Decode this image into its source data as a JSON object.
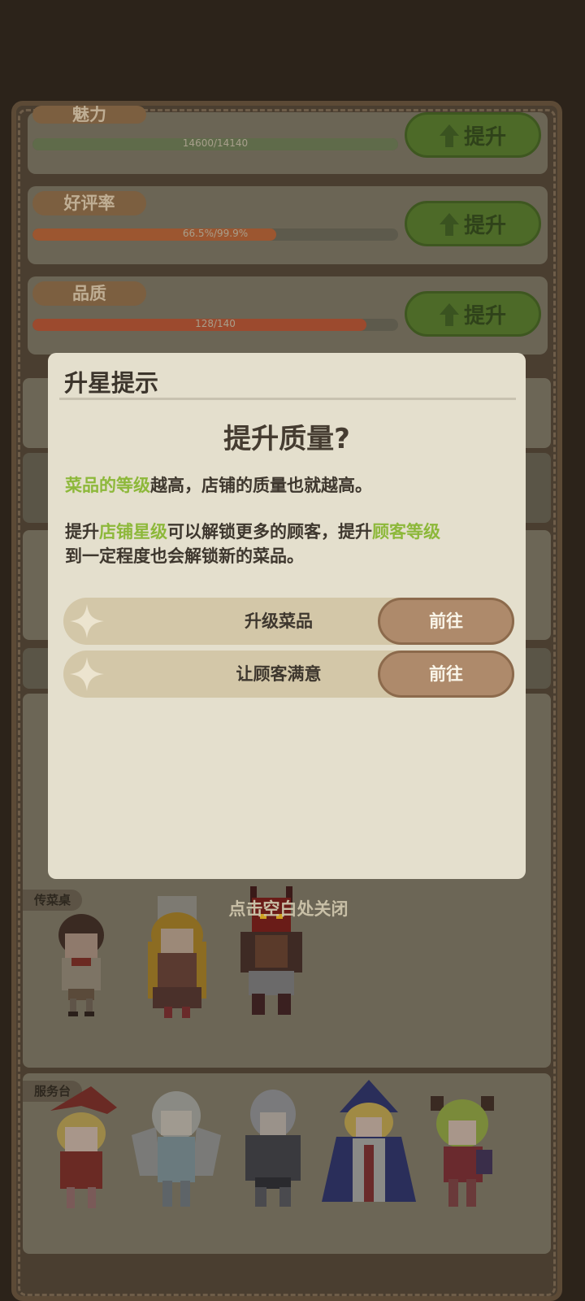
{
  "stats": [
    {
      "label": "魅力",
      "bar_text": "14600/14140",
      "progress": 1.0,
      "color": "#5f6b4a",
      "button": "提升"
    },
    {
      "label": "好评率",
      "bar_text": "66.5%/99.9%",
      "progress": 0.666,
      "color": "#9c5630",
      "button": "提升"
    },
    {
      "label": "品质",
      "bar_text": "128/140",
      "progress": 0.914,
      "color": "#9c4a2e",
      "button": "提升"
    }
  ],
  "sections": {
    "serving_table": "传菜桌",
    "service_desk": "服务台"
  },
  "dialog": {
    "title": "升星提示",
    "heading": "提升质量?",
    "para1": {
      "hl1": "菜品的等级",
      "rest": "越高，店铺的质量也就越高。"
    },
    "para2": {
      "pre": "提升",
      "hl1": "店铺星级",
      "mid": "可以解锁更多的顾客，提升",
      "hl2": "顾客等级",
      "post": "到一定程度也会解锁新的菜品。"
    },
    "tasks": [
      {
        "label": "升级菜品",
        "button": "前往"
      },
      {
        "label": "让顾客满意",
        "button": "前往"
      }
    ]
  },
  "close_hint": "点击空白处关闭",
  "colors": {
    "highlight": "#8db83a",
    "go_button": "#ae8a6b",
    "dialog_bg": "#e4dfcd"
  }
}
